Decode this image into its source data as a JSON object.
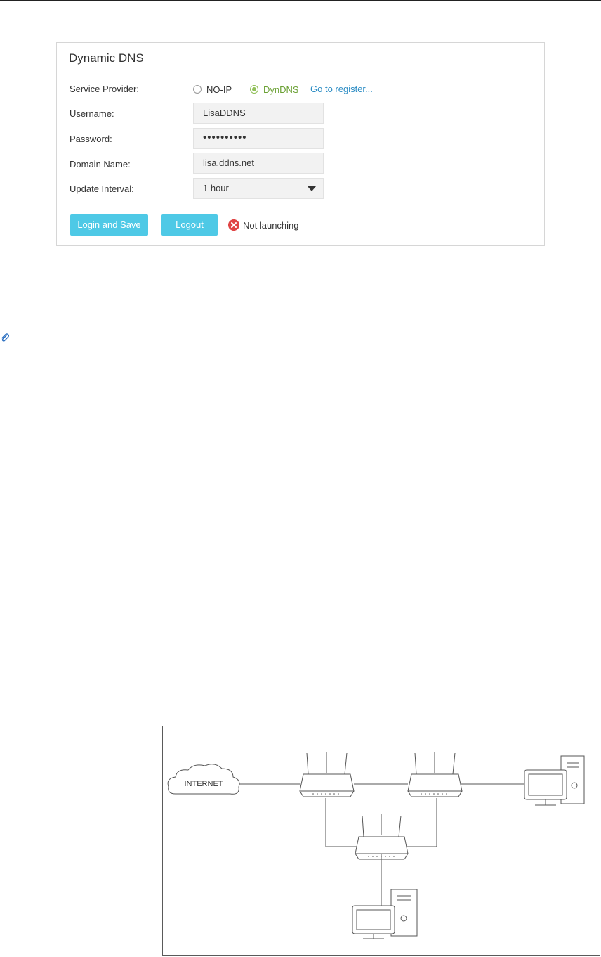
{
  "panel": {
    "title": "Dynamic DNS",
    "service_provider_label": "Service Provider:",
    "providers": [
      "NO-IP",
      "DynDNS"
    ],
    "selected_provider": "DynDNS",
    "register_link": "Go to register...",
    "username_label": "Username:",
    "username_value": "LisaDDNS",
    "password_label": "Password:",
    "password_value": "••••••••••",
    "domain_label": "Domain Name:",
    "domain_value": "lisa.ddns.net",
    "interval_label": "Update Interval:",
    "interval_value": "1 hour",
    "login_button": "Login and Save",
    "logout_button": "Logout",
    "status_text": "Not launching"
  },
  "diagram": {
    "cloud_label": "INTERNET"
  },
  "colors": {
    "accent_button": "#4ec9e6",
    "link": "#2b8cc4",
    "radio_selected": "#8fbf57",
    "status_error": "#e04444"
  },
  "icons": [
    "radio-unchecked-icon",
    "radio-checked-icon",
    "dropdown-arrow-icon",
    "error-circle-icon",
    "paperclip-icon",
    "router-icon",
    "desktop-computer-icon",
    "cloud-icon"
  ]
}
